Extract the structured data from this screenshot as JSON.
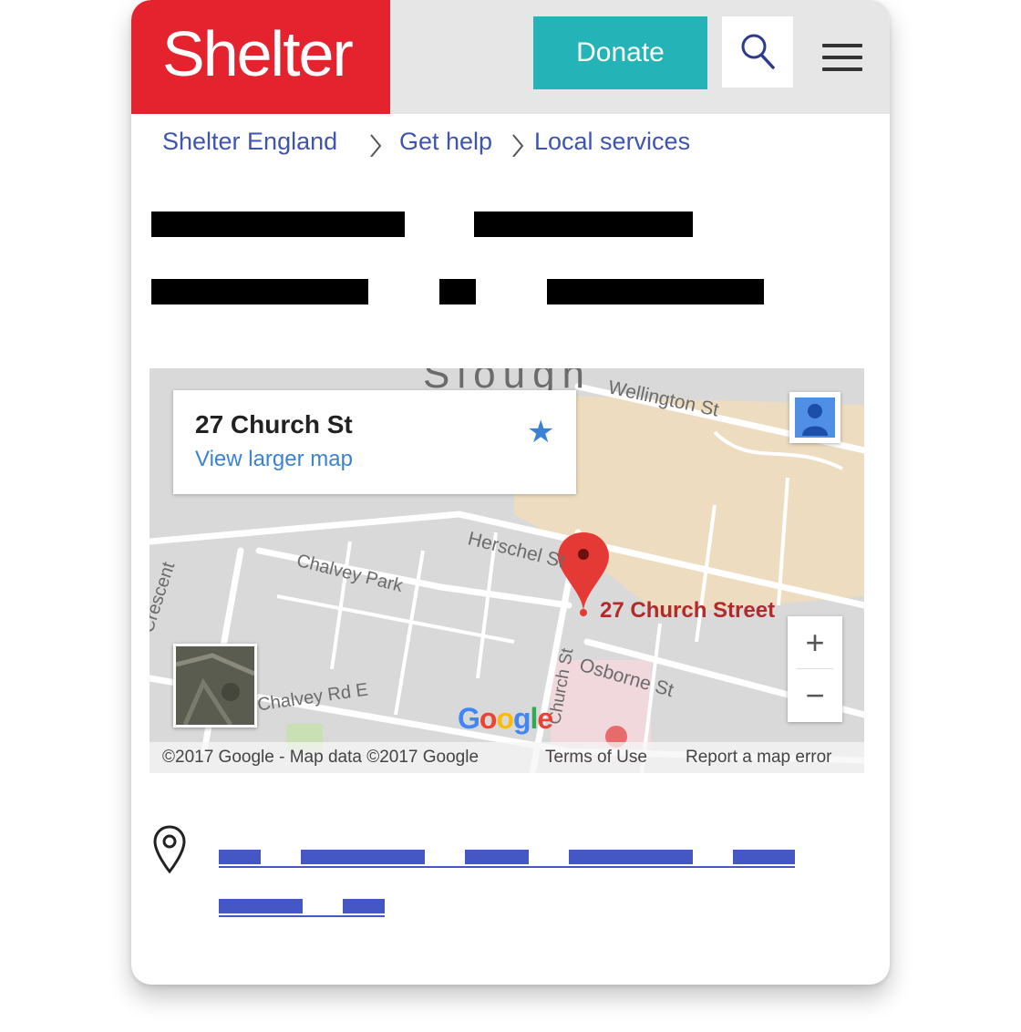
{
  "header": {
    "logo": "Shelter",
    "donate_label": "Donate",
    "brand_color": "#e4232f",
    "donate_color": "#24b4b8"
  },
  "breadcrumb": {
    "items": [
      "Shelter England",
      "Get help",
      "Local services"
    ],
    "separator": ">"
  },
  "map": {
    "infobox_title": "27 Church St",
    "infobox_link": "View larger map",
    "pin_label": "27 Church Street",
    "town_label": "Slough",
    "streets": [
      "Wellington St",
      "Herschel St",
      "Chalvey Park",
      "Osborne St",
      "Church St",
      "Chalvey Rd E",
      "Crescent"
    ],
    "google_logo": "Google",
    "attribution": "©2017 Google - Map data ©2017 Google",
    "terms": "Terms of Use",
    "report": "Report a map error",
    "zoom_in": "+",
    "zoom_out": "−"
  },
  "icons": [
    "search-icon",
    "menu-icon",
    "star-icon",
    "pegman-icon",
    "location-pin-icon",
    "map-marker-icon"
  ]
}
